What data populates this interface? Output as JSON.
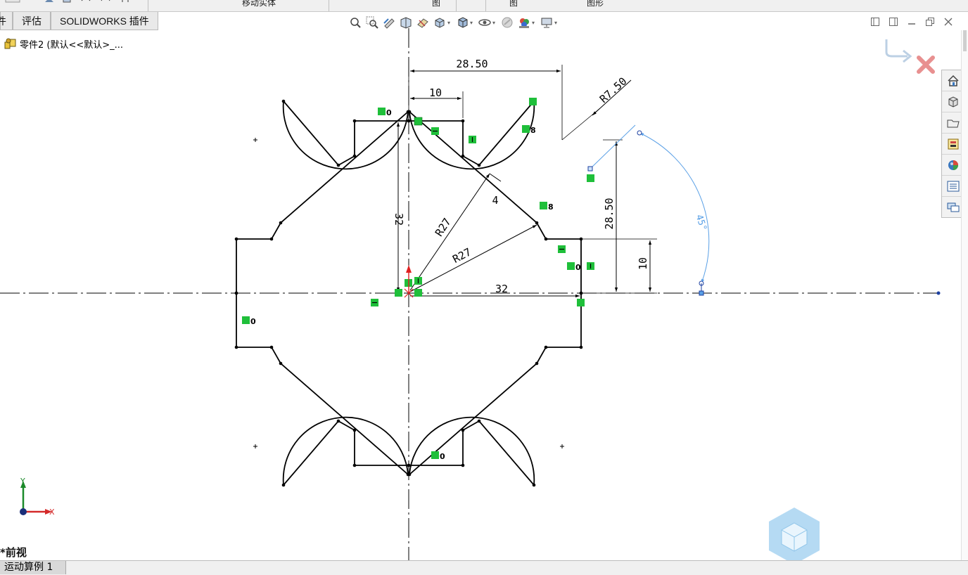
{
  "window": {
    "top_strip": [
      "移动实体",
      "图",
      "图",
      "图形"
    ],
    "tabs": [
      {
        "label": "件",
        "name": "tab-part"
      },
      {
        "label": "评估",
        "name": "tab-evaluate"
      },
      {
        "label": "SOLIDWORKS 插件",
        "name": "tab-solidworks-addins"
      }
    ]
  },
  "feature_tree": {
    "root_label": "零件2  (默认<<默认>_..."
  },
  "heads_up_toolbar": {
    "icons": [
      "zoom-to-fit-icon",
      "zoom-to-area-icon",
      "previous-view-icon",
      "section-view-icon",
      "dynamic-annotation-icon",
      "view-orientation-icon",
      "display-style-icon",
      "hide-show-icon",
      "edit-appearance-icon",
      "apply-scene-icon",
      "view-settings-icon"
    ]
  },
  "window_controls": [
    "restore-left-icon",
    "restore-right-icon",
    "minimize-icon",
    "maximize-icon",
    "close-icon"
  ],
  "task_pane": {
    "buttons": [
      "home-icon",
      "3d-content-icon",
      "design-library-icon",
      "file-explorer-icon",
      "appearances-icon",
      "custom-properties-icon",
      "forum-icon"
    ]
  },
  "sketch": {
    "dimensions": {
      "d_top_width": "28.50",
      "d_notch_width": "10",
      "d_radius_small": "R7.50",
      "d_left_height": "32",
      "d_gap": "4",
      "d_r27_a": "R27",
      "d_r27_b": "R27",
      "d_right_height": "28.50",
      "d_notch_height": "10",
      "d_bottom_width": "32",
      "d_angle": "45°"
    },
    "relation_labels": {
      "r_top": "0",
      "r_diag_upper": "8",
      "r_diag_lower": "8",
      "r_right": "0",
      "r_left": "0",
      "r_bottom": "0"
    }
  },
  "triad": {
    "x_label": "X",
    "y_label": "Y"
  },
  "view": {
    "name": "*前视"
  },
  "bottom_tabs": [
    {
      "label": "运动算例 1"
    }
  ],
  "colors": {
    "sketch_line": "#000000",
    "relation_green": "#1fbf3a",
    "construction_blue": "#5aa0e6",
    "origin_red": "#e02020",
    "confirm_red": "#e89090"
  }
}
